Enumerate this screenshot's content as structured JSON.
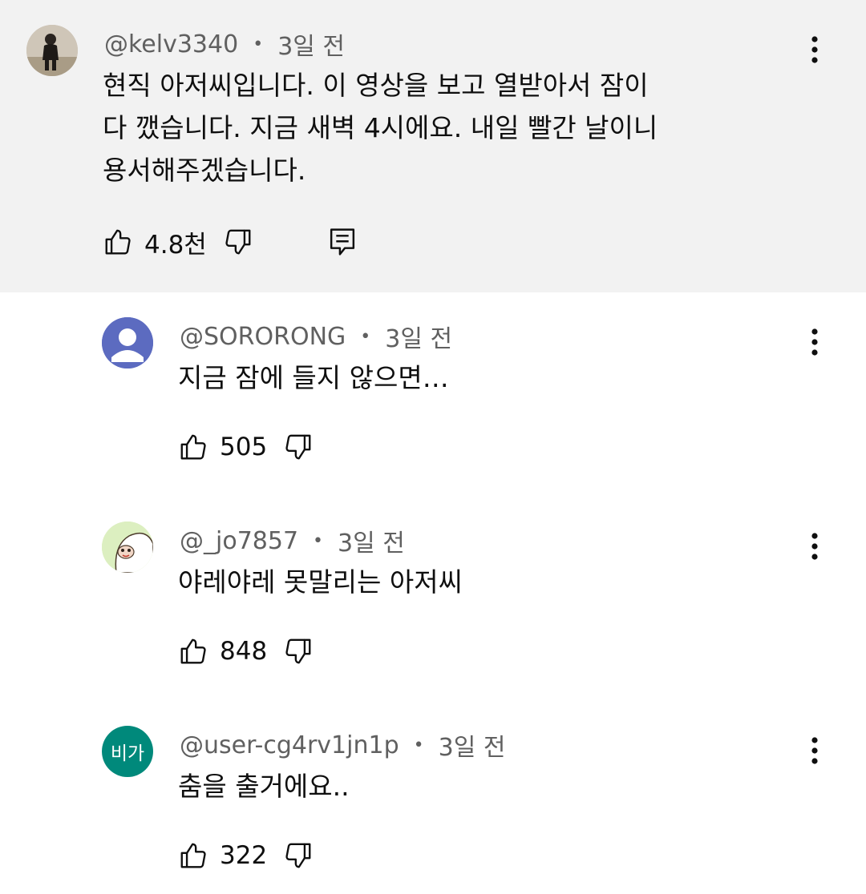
{
  "comments": [
    {
      "author": "@kelv3340",
      "time": "3일 전",
      "lines": [
        "현직 아저씨입니다. 이 영상을 보고 열받아서 잠이",
        "다 깼습니다. 지금 새벽 4시에요. 내일 빨간 날이니",
        "용서해주겠습니다."
      ],
      "likes": "4.8천",
      "avatar": "photo"
    },
    {
      "author": "@SORORONG",
      "time": "3일 전",
      "lines": [
        "지금 잠에 들지 않으면…"
      ],
      "likes": "505",
      "avatar": "default-person"
    },
    {
      "author": "@_jo7857",
      "time": "3일 전",
      "lines": [
        "야레야레 못말리는 아저씨"
      ],
      "likes": "848",
      "avatar": "cartoon"
    },
    {
      "author": "@user-cg4rv1jn1p",
      "time": "3일 전",
      "lines": [
        "춤을 출거에요.."
      ],
      "likes": "322",
      "avatar": "initials",
      "avatar_text": "비가"
    }
  ],
  "icons": {
    "like": "thumb-up-icon",
    "dislike": "thumb-down-icon",
    "reply": "reply-icon",
    "more": "more-vert-icon"
  },
  "colors": {
    "highlight_bg": "#f2f2f2",
    "meta_text": "#606060",
    "default_avatar": "#5c6bc0",
    "initials_avatar": "#00897b"
  }
}
